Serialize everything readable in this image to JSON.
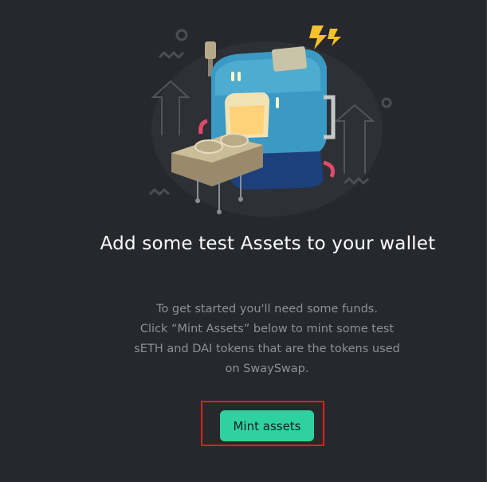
{
  "onboarding": {
    "title": "Add some test Assets to your wallet",
    "description_lines": [
      "To get started you'll need some funds.",
      "Click “Mint Assets” below to mint some test",
      "sETH and DAI tokens that are the tokens used",
      "on SwaySwap."
    ],
    "mint_button_label": "Mint assets"
  },
  "colors": {
    "background": "#26282d",
    "accent": "#2fd1a2",
    "highlight_border": "#e0201a",
    "title": "#ffffff",
    "description": "#8b9099"
  },
  "icons": {
    "illustration": "minting-machine-illustration"
  }
}
